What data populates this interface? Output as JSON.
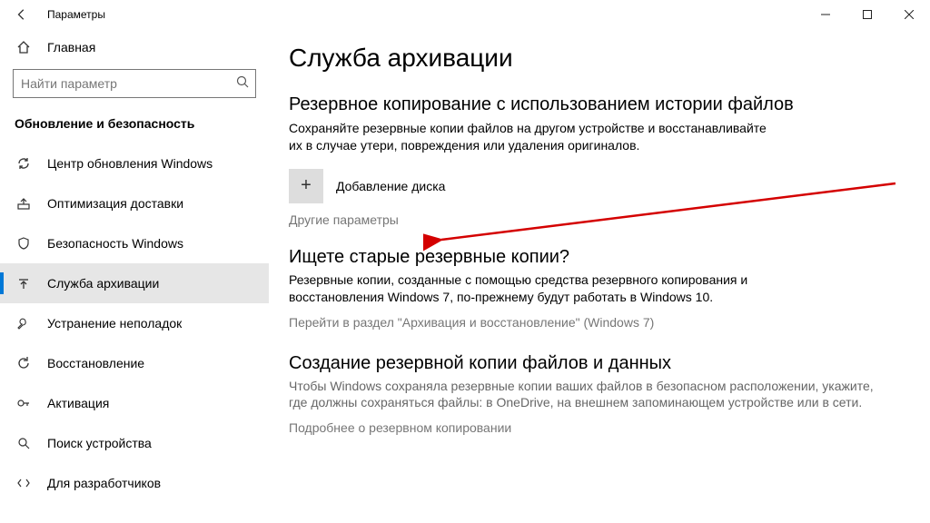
{
  "window": {
    "title": "Параметры",
    "minimize": "–",
    "maximize": "▢",
    "close": "✕"
  },
  "sidebar": {
    "home": "Главная",
    "search_placeholder": "Найти параметр",
    "section": "Обновление и безопасность",
    "items": [
      {
        "label": "Центр обновления Windows"
      },
      {
        "label": "Оптимизация доставки"
      },
      {
        "label": "Безопасность Windows"
      },
      {
        "label": "Служба архивации"
      },
      {
        "label": "Устранение неполадок"
      },
      {
        "label": "Восстановление"
      },
      {
        "label": "Активация"
      },
      {
        "label": "Поиск устройства"
      },
      {
        "label": "Для разработчиков"
      }
    ]
  },
  "content": {
    "page_title": "Служба архивации",
    "section1_title": "Резервное копирование с использованием истории файлов",
    "section1_desc": "Сохраняйте резервные копии файлов на другом устройстве и восстанавливайте их в случае утери, повреждения или удаления оригиналов.",
    "add_disk_label": "Добавление диска",
    "more_options": "Другие параметры",
    "section2_title": "Ищете старые резервные копии?",
    "section2_desc": "Резервные копии, созданные с помощью средства резервного копирования и восстановления Windows 7, по-прежнему будут работать в Windows 10.",
    "goto_link": "Перейти в раздел \"Архивация и восстановление\" (Windows 7)",
    "section3_title": "Создание резервной копии файлов и данных",
    "section3_desc": "Чтобы Windows сохраняла резервные копии ваших файлов в безопасном расположении, укажите, где должны сохраняться файлы: в OneDrive, на внешнем запоминающем устройстве или в сети.",
    "learn_more": "Подробнее о резервном копировании"
  },
  "annotation": {
    "type": "arrow",
    "color": "#d40000"
  }
}
